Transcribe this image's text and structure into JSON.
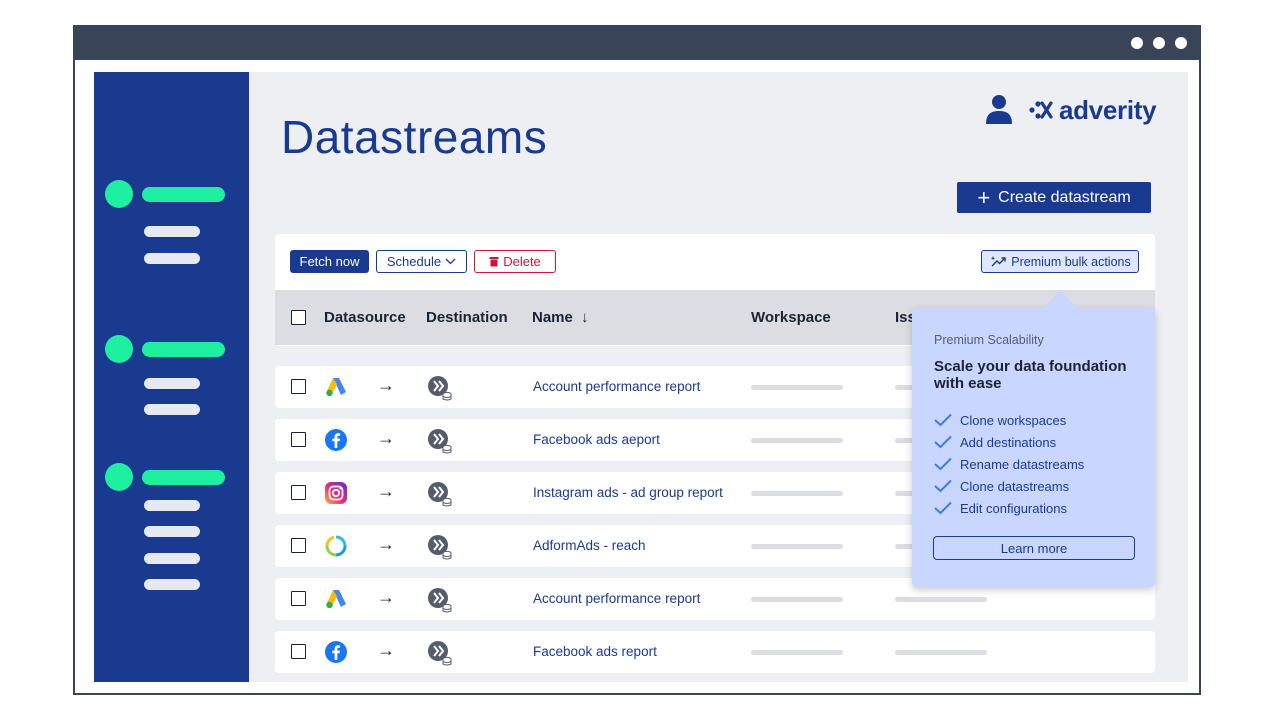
{
  "window": {
    "controls": [
      "dot",
      "dot",
      "dot"
    ]
  },
  "sidebar": {
    "groups": [
      {
        "icon": "nav-dot",
        "bars": 2
      },
      {
        "icon": "nav-dot",
        "bars": 2
      },
      {
        "icon": "nav-dot",
        "bars": 4
      }
    ]
  },
  "header": {
    "title": "Datastreams",
    "user_icon": "user-icon",
    "logo_text": "adverity",
    "create_button": {
      "icon": "+",
      "label": "Create datastream"
    }
  },
  "toolbar": {
    "fetch_label": "Fetch now",
    "schedule_label": "Schedule",
    "delete_label": "Delete",
    "premium_label": "Premium bulk actions"
  },
  "table": {
    "columns": [
      "Datasource",
      "Destination",
      "Name",
      "Workspace",
      "Iss"
    ],
    "sort_indicator": "↓",
    "rows": [
      {
        "datasource": "google-ads",
        "destination": "warehouse",
        "name": "Account performance report"
      },
      {
        "datasource": "facebook",
        "destination": "warehouse",
        "name": "Facebook ads aeport"
      },
      {
        "datasource": "instagram",
        "destination": "warehouse",
        "name": "Instagram ads - ad group report"
      },
      {
        "datasource": "adform",
        "destination": "warehouse",
        "name": "AdformAds - reach"
      },
      {
        "datasource": "google-ads",
        "destination": "warehouse",
        "name": "Account performance report"
      },
      {
        "datasource": "facebook",
        "destination": "warehouse",
        "name": "Facebook ads report"
      }
    ]
  },
  "popover": {
    "eyebrow": "Premium Scalability",
    "title": "Scale your data foundation with ease",
    "items": [
      "Clone workspaces",
      "Add destinations",
      "Rename datastreams",
      "Clone datastreams",
      "Edit configurations"
    ],
    "cta": "Learn more"
  },
  "colors": {
    "brand": "#1a3a8f",
    "accent_green": "#1fefa0",
    "delete_red": "#d0143a",
    "popover_bg": "#c9d6ff",
    "titlebar": "#3a4458"
  }
}
